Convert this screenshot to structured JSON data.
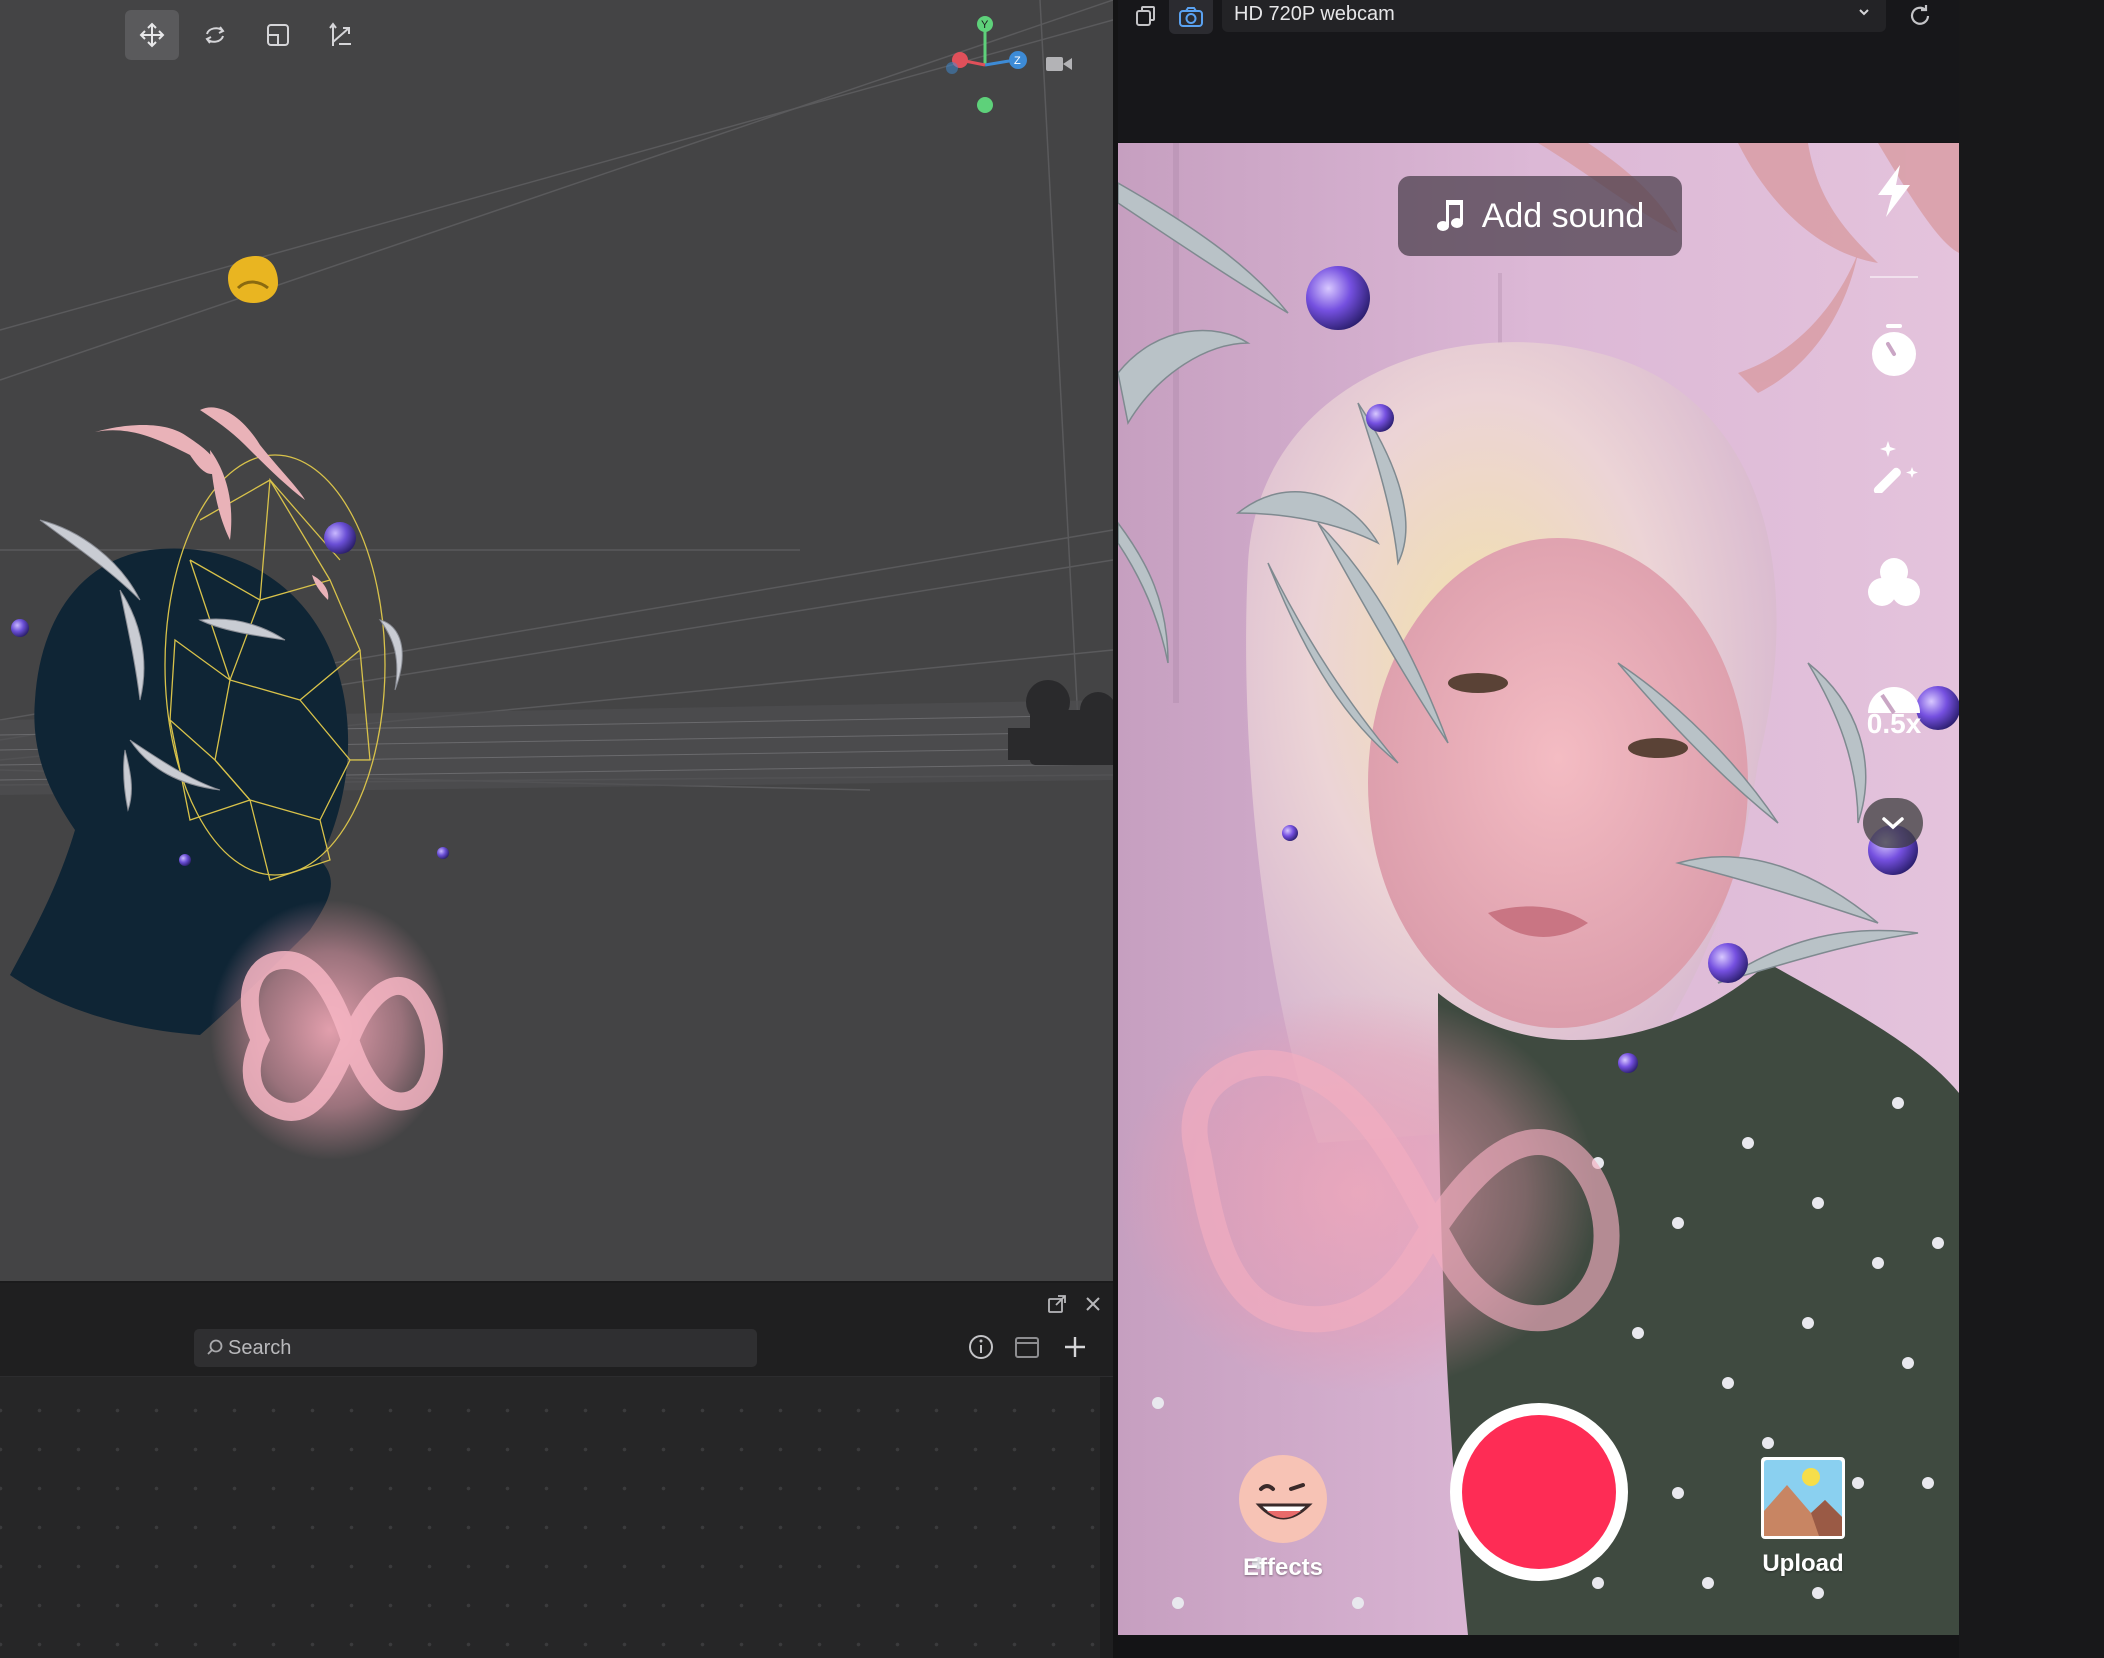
{
  "scene_toolbar": {
    "tools": [
      "move-tool",
      "rotate-tool",
      "scale-tool",
      "transform-tool"
    ],
    "active_tool": "move-tool"
  },
  "axis_gizmo": {
    "y_label": "Y",
    "z_label": "Z"
  },
  "scene_panel": {
    "search": {
      "placeholder": "Search",
      "value": ""
    }
  },
  "preview": {
    "camera_source": "HD 720P webcam",
    "add_sound_label": "Add sound",
    "speed_label": "0.5x",
    "effects_label": "Effects",
    "upload_label": "Upload",
    "record_color": "#fe2c55"
  },
  "colors": {
    "scene_bg": "#444445",
    "panel_bg": "#1f1f20",
    "accent_record": "#fe2c55",
    "axis_x": "#e0505a",
    "axis_y": "#5ed17a",
    "axis_z": "#3d8bd6"
  }
}
